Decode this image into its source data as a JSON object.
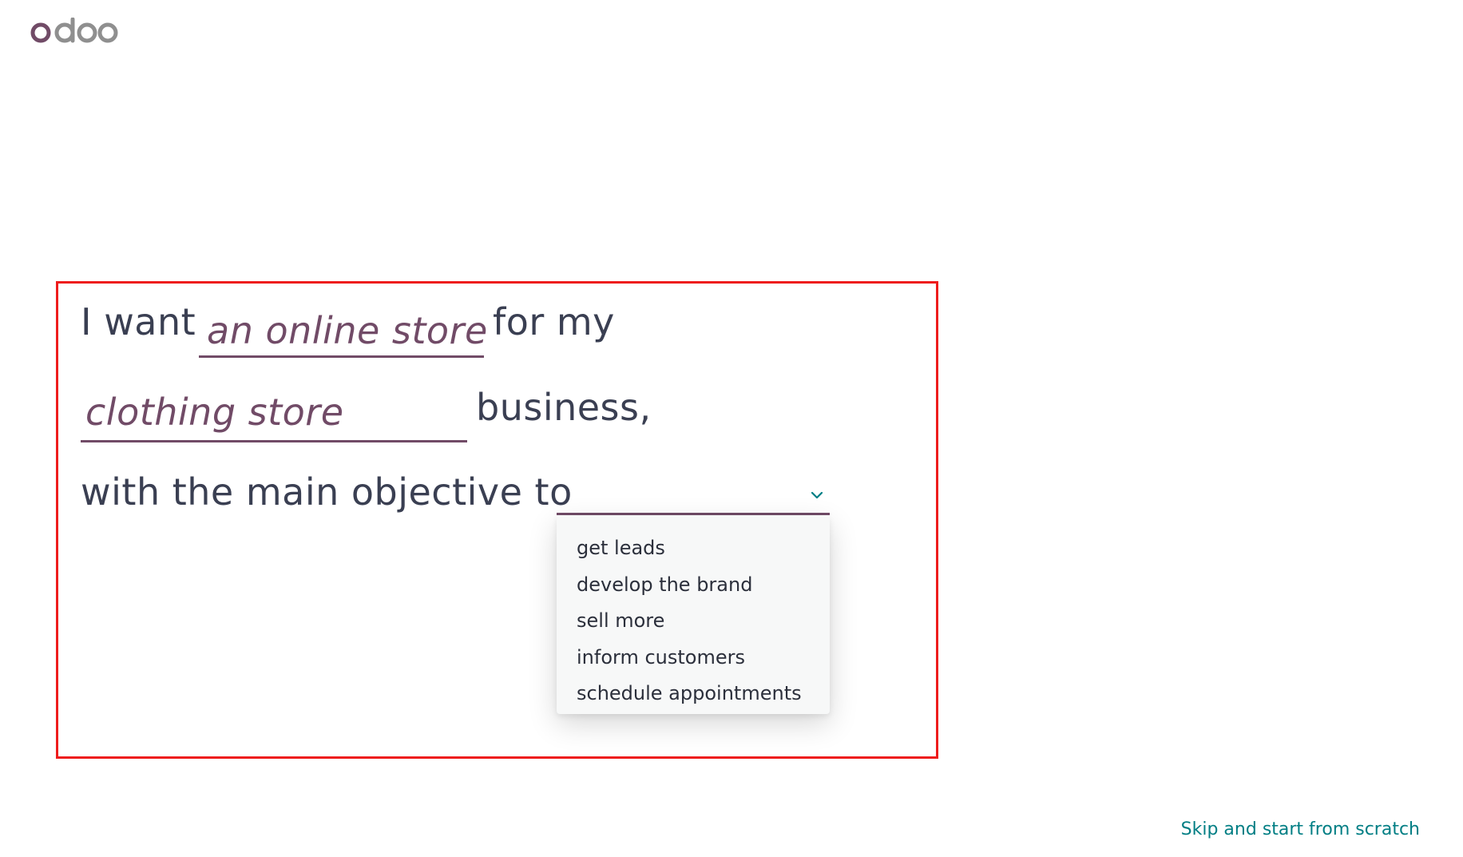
{
  "brand": {
    "logo_text": "odoo",
    "logo_colors": {
      "primary": "#714b67",
      "secondary": "#8f8f8f"
    }
  },
  "form": {
    "line1_prefix": "I want",
    "website_type_value": "an online store",
    "line1_suffix": "for my",
    "industry_value": "clothing store",
    "line2_suffix": "business,",
    "line3_prefix": "with the main objective to",
    "objective_value": ""
  },
  "objective_dropdown": {
    "options": [
      "get leads",
      "develop the brand",
      "sell more",
      "inform customers",
      "schedule appointments"
    ]
  },
  "footer": {
    "skip_label": "Skip and start from scratch"
  },
  "colors": {
    "accent": "#714b67",
    "link": "#017e84",
    "highlight_frame": "#ee1c1c",
    "text": "#3a3f52"
  }
}
